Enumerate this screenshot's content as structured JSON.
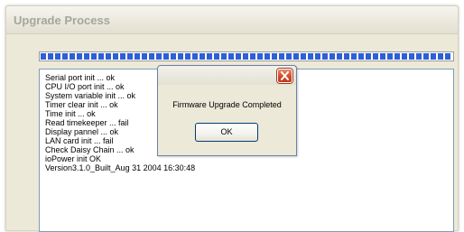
{
  "window": {
    "title": "Upgrade Process"
  },
  "progress": {
    "fraction": 1.0,
    "color": "#2f5fd6"
  },
  "log": {
    "lines": [
      "Serial port init ... ok",
      "CPU I/O port init ... ok",
      "System variable init ... ok",
      "Timer clear init ... ok",
      "Time init ... ok",
      "Read timekeeper ... fail",
      "Display pannel ... ok",
      "LAN card init ... fail",
      "Check Daisy Chain ... ok",
      "ioPower init OK",
      "Version3.1.0_Built_Aug 31 2004 16:30:48"
    ]
  },
  "dialog": {
    "message": "Firmware Upgrade Completed",
    "ok_label": "OK",
    "close_icon": "close-icon",
    "close_color": "#d24a2a"
  }
}
